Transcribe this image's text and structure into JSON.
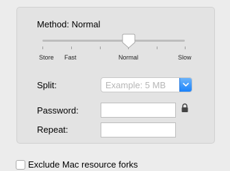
{
  "method": {
    "title": "Method: Normal",
    "slider": {
      "labels": [
        "Store",
        "Fast",
        "Normal",
        "Slow"
      ],
      "selected": "Normal",
      "ticks_count": 6,
      "selected_index": 3
    }
  },
  "split": {
    "label": "Split:",
    "placeholder": "Example: 5 MB"
  },
  "password": {
    "label": "Password:",
    "value": ""
  },
  "repeat": {
    "label": "Repeat:",
    "value": ""
  },
  "exclude_forks": {
    "label": "Exclude Mac resource forks",
    "checked": false
  },
  "colors": {
    "accent": "#1a82fb",
    "panel_bg": "#e3e3e3",
    "window_bg": "#ececec",
    "placeholder": "#b6b6b6"
  },
  "icons": {
    "lock": "lock-icon",
    "select_arrow": "chevron-down-icon",
    "slider_thumb": "slider-thumb"
  }
}
